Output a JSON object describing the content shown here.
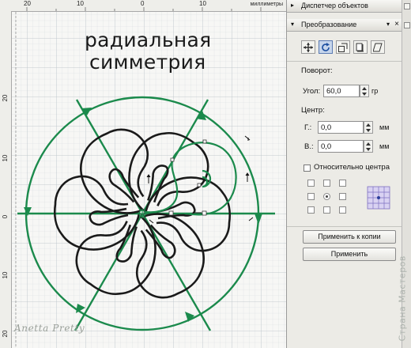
{
  "canvas": {
    "ruler_unit": "миллиметры",
    "ruler_top_numbers": [
      "20",
      "10",
      "0",
      "10",
      "20"
    ],
    "ruler_left_numbers": [
      "20",
      "10",
      "0",
      "10",
      "20"
    ],
    "title_line_1": "радиальная",
    "title_line_2": "симметрия",
    "watermark_left": "Anetta Pretty",
    "watermark_right": "Страна Мастеров",
    "colors": {
      "guide_green": "#1b8a4c",
      "shape_black": "#1a1a1a",
      "grid": "#d4d9dd"
    }
  },
  "docker": {
    "object_manager_label": "Диспетчер объектов",
    "transform_label": "Преобразование",
    "tools": [
      {
        "name": "position-icon"
      },
      {
        "name": "rotate-icon",
        "active": true
      },
      {
        "name": "scale-icon"
      },
      {
        "name": "size-icon"
      },
      {
        "name": "skew-icon"
      }
    ],
    "rotation_heading": "Поворот:",
    "angle_label": "Угол:",
    "angle_value": "60,0",
    "angle_unit": "гр",
    "center_heading": "Центр:",
    "h_label": "Г.:",
    "h_value": "0,0",
    "h_unit": "мм",
    "v_label": "В.:",
    "v_value": "0,0",
    "v_unit": "мм",
    "relative_center_label": "Относительно центра",
    "relative_center_checked": false,
    "apply_to_duplicate_label": "Применить к копии",
    "apply_label": "Применить"
  }
}
